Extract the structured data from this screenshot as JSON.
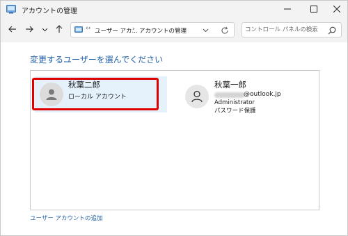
{
  "window": {
    "title": "アカウントの管理",
    "icon": "control-panel-icon"
  },
  "caption_buttons": [
    "minimize-icon",
    "maximize-icon",
    "close-icon"
  ],
  "nav": {
    "back_icon": "arrow-left-icon",
    "forward_icon": "arrow-right-icon",
    "recent_icon": "chevron-down-icon",
    "up_icon": "arrow-up-icon",
    "address": {
      "chevrons": "‹‹",
      "crumb_parent": "ユーザー アカ...",
      "separator": "›",
      "crumb_current": "アカウントの管理"
    },
    "search_placeholder": "コントロール パネルの検索"
  },
  "main": {
    "heading": "変更するユーザーを選んでください",
    "accounts": [
      {
        "name": "秋葉二郎",
        "type": "ローカル アカウント",
        "selected": true
      },
      {
        "name": "秋葉一郎",
        "email_domain": "@outlook.jp",
        "role": "Administrator",
        "protection": "パスワード保護"
      }
    ],
    "add_account_link": "ユーザー アカウントの追加"
  },
  "colors": {
    "heading": "#1f5fa6",
    "selected_bg": "#e5f1fb",
    "highlight_border": "#e00000",
    "titlebar_bg": "#f3f3f3"
  }
}
